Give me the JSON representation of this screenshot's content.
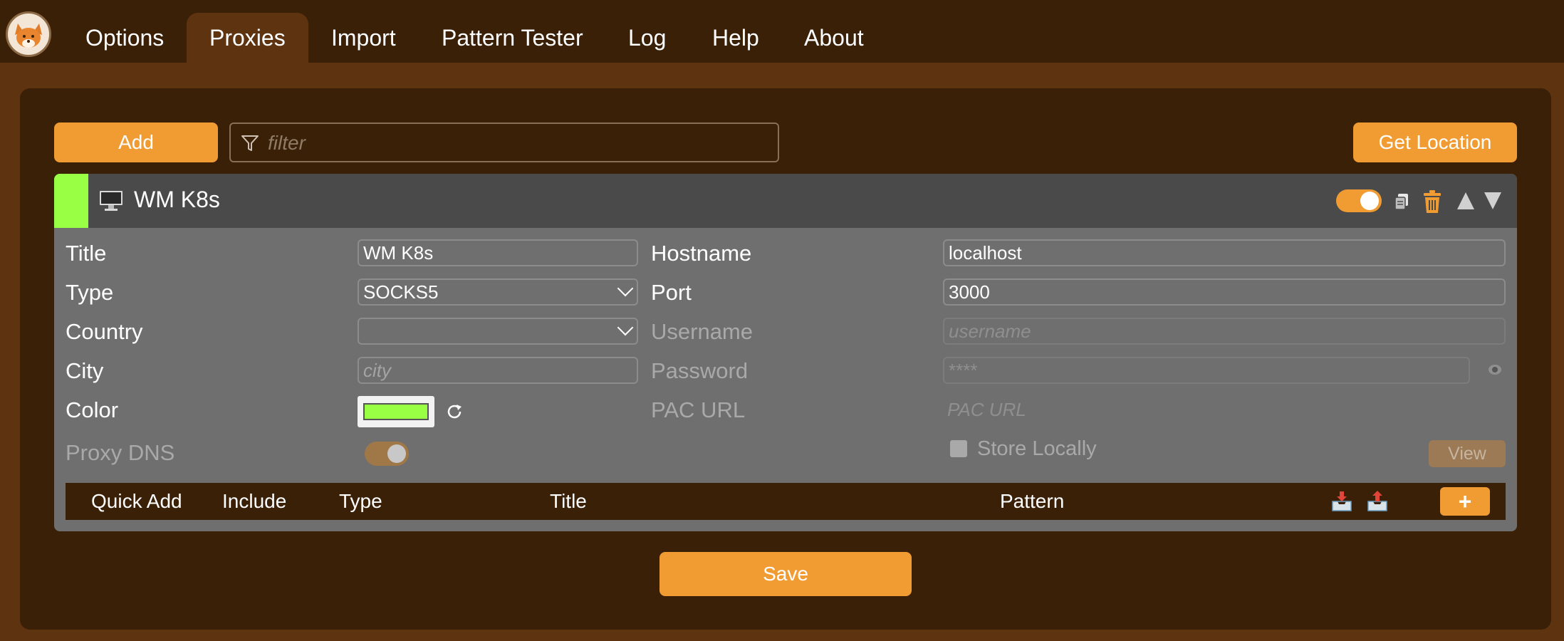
{
  "nav": {
    "tabs": [
      "Options",
      "Proxies",
      "Import",
      "Pattern Tester",
      "Log",
      "Help",
      "About"
    ],
    "active": "Proxies"
  },
  "toolbar": {
    "add_label": "Add",
    "filter_placeholder": "filter",
    "get_location_label": "Get Location"
  },
  "proxy": {
    "header_title": "WM K8s",
    "color": "#99ff44",
    "labels": {
      "title": "Title",
      "type": "Type",
      "country": "Country",
      "city": "City",
      "color": "Color",
      "proxy_dns": "Proxy DNS",
      "hostname": "Hostname",
      "port": "Port",
      "username": "Username",
      "password": "Password",
      "pac_url": "PAC URL",
      "store_locally": "Store Locally",
      "view": "View"
    },
    "values": {
      "title": "WM K8s",
      "type": "SOCKS5",
      "country": "",
      "hostname": "localhost",
      "port": "3000"
    },
    "placeholders": {
      "city": "city",
      "username": "username",
      "password": "****",
      "pac_url": "PAC URL"
    },
    "enabled": true,
    "proxy_dns_enabled": true,
    "store_locally": false
  },
  "rules": {
    "headers": [
      "Quick Add",
      "Include",
      "Type",
      "Title",
      "Pattern"
    ],
    "add_label": "+"
  },
  "save_label": "Save",
  "colors": {
    "accent": "#f19c33",
    "background": "#5e3410",
    "panel": "#3b2008",
    "card": "#6f6f6f"
  }
}
